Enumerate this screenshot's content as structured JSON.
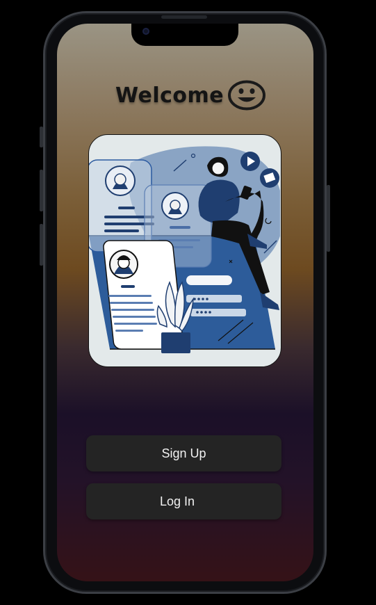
{
  "header": {
    "title": "Welcome",
    "icon": "smiling-face-icon"
  },
  "illustration": {
    "subject": "woman-with-phone-and-profile-cards-illustration"
  },
  "actions": {
    "signup_label": "Sign Up",
    "login_label": "Log In"
  },
  "colors": {
    "button_bg": "#242424",
    "button_text": "#f2f2f2",
    "illustration_blue": "#2b5aa0",
    "title_color": "#141414"
  }
}
